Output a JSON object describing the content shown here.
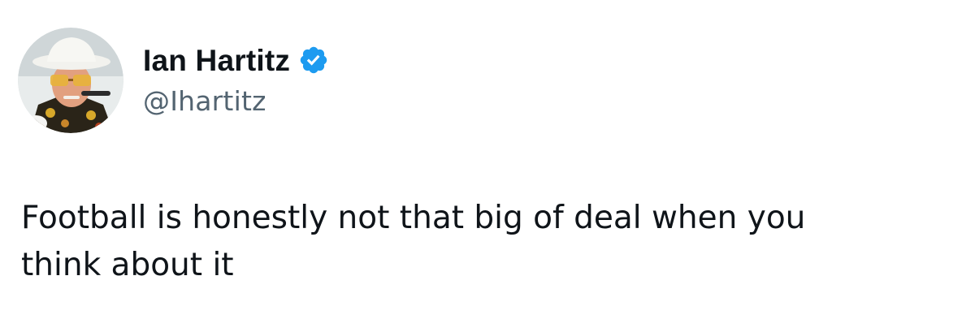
{
  "tweet": {
    "author": {
      "display_name": "Ian Hartitz",
      "handle": "@Ihartitz",
      "verified": true,
      "avatar_icon": "profile-photo-avatar",
      "verified_icon": "verified-badge-icon"
    },
    "text": "Football is honestly not that big of deal when you\nthink about it"
  },
  "colors": {
    "background": "#ffffff",
    "text_primary": "#0f1419",
    "text_secondary": "#536471",
    "verified_blue": "#1d9bf0"
  }
}
